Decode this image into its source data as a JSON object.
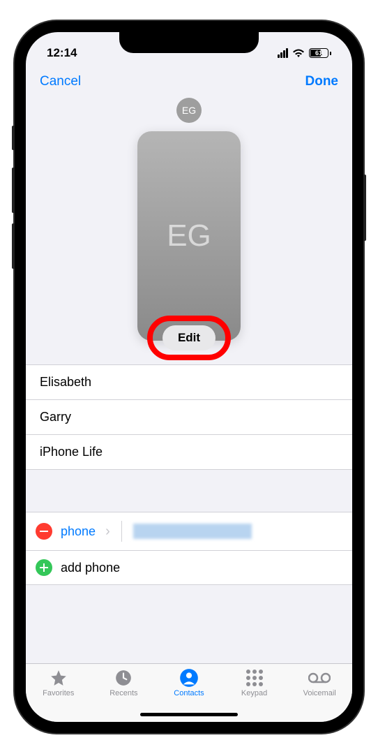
{
  "status": {
    "time": "12:14",
    "battery_percent": "61"
  },
  "nav": {
    "cancel": "Cancel",
    "done": "Done"
  },
  "poster": {
    "small_initials": "EG",
    "large_initials": "EG",
    "edit_label": "Edit"
  },
  "fields": {
    "first_name": "Elisabeth",
    "last_name": "Garry",
    "company": "iPhone Life"
  },
  "phone": {
    "type_label": "phone",
    "add_label": "add phone"
  },
  "tabs": {
    "favorites": "Favorites",
    "recents": "Recents",
    "contacts": "Contacts",
    "keypad": "Keypad",
    "voicemail": "Voicemail"
  }
}
